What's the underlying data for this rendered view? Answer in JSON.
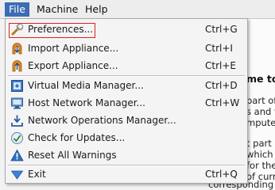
{
  "menubar": {
    "file": "File",
    "machine": "Machine",
    "help": "Help"
  },
  "menu": {
    "items": [
      {
        "label": "Preferences...",
        "shortcut": "Ctrl+G",
        "icon": "wrench-icon"
      },
      {
        "label": "Import Appliance...",
        "shortcut": "Ctrl+I",
        "icon": "import-appliance-icon"
      },
      {
        "label": "Export Appliance...",
        "shortcut": "Ctrl+E",
        "icon": "export-appliance-icon"
      },
      {
        "label": "Virtual Media Manager...",
        "shortcut": "Ctrl+D",
        "icon": "media-manager-icon"
      },
      {
        "label": "Host Network Manager...",
        "shortcut": "Ctrl+W",
        "icon": "host-network-icon"
      },
      {
        "label": "Network Operations Manager...",
        "shortcut": "",
        "icon": "network-operations-icon"
      },
      {
        "label": "Check for Updates...",
        "shortcut": "",
        "icon": "check-updates-icon"
      },
      {
        "label": "Reset All Warnings",
        "shortcut": "",
        "icon": "warning-icon"
      },
      {
        "label": "Exit",
        "shortcut": "Ctrl+Q",
        "icon": "exit-icon"
      }
    ]
  },
  "background": {
    "heading": "me to",
    "lines": [
      "part of t",
      "s and v",
      "mputer.",
      "t part of",
      "which a",
      "for the",
      "of curr"
    ],
    "tail": "corresponding m"
  }
}
